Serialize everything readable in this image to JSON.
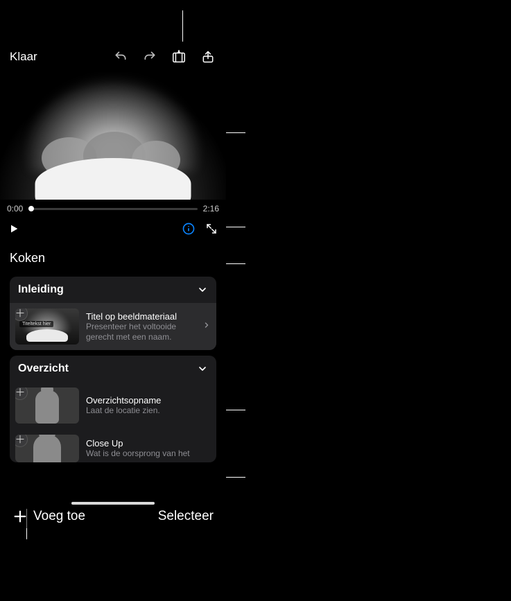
{
  "toolbar": {
    "done_label": "Klaar"
  },
  "player": {
    "current_time": "0:00",
    "duration": "2:16"
  },
  "project_title": "Koken",
  "sections": [
    {
      "title": "Inleiding",
      "clips": [
        {
          "title": "Titel op beeldmateriaal",
          "subtitle": "Presenteer het voltooide gerecht met een naam.",
          "thumb_label": "Titeltekst hier"
        }
      ]
    },
    {
      "title": "Overzicht",
      "clips": [
        {
          "title": "Overzichtsopname",
          "subtitle": "Laat de locatie zien."
        },
        {
          "title": "Close Up",
          "subtitle": "Wat is de oorsprong van het"
        }
      ]
    }
  ],
  "bottom_bar": {
    "add_label": "Voeg toe",
    "select_label": "Selecteer"
  }
}
